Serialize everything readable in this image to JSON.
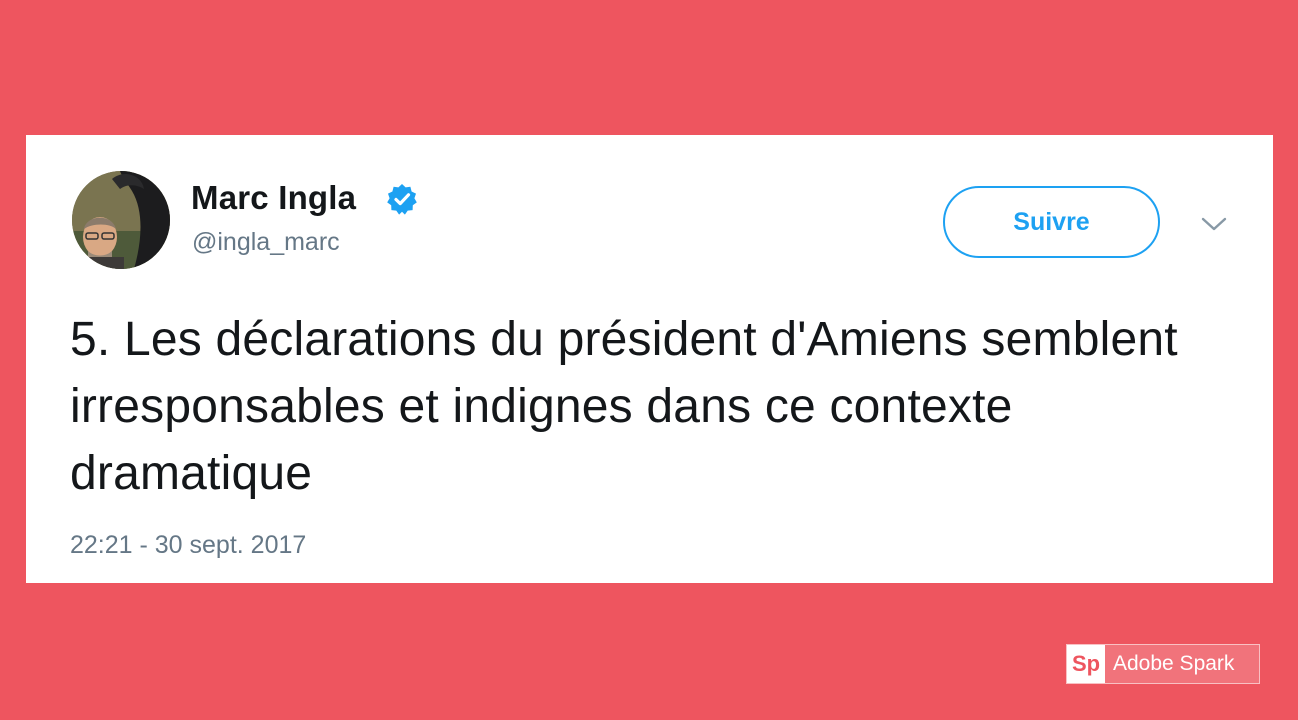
{
  "tweet": {
    "author": {
      "name": "Marc Ingla",
      "handle": "@ingla_marc",
      "verified": true
    },
    "follow_label": "Suivre",
    "text": "5. Les déclarations du président d'Amiens semblent irresponsables et indignes dans ce contexte dramatique",
    "timestamp": "22:21 - 30 sept. 2017"
  },
  "watermark": {
    "logo_text": "Sp",
    "label": "Adobe Spark"
  },
  "colors": {
    "background": "#ee555f",
    "card": "#ffffff",
    "accent": "#1da1f2",
    "text": "#14171a",
    "muted": "#657786"
  },
  "icons": {
    "verified": "verified-badge-icon",
    "menu": "chevron-down-icon"
  }
}
